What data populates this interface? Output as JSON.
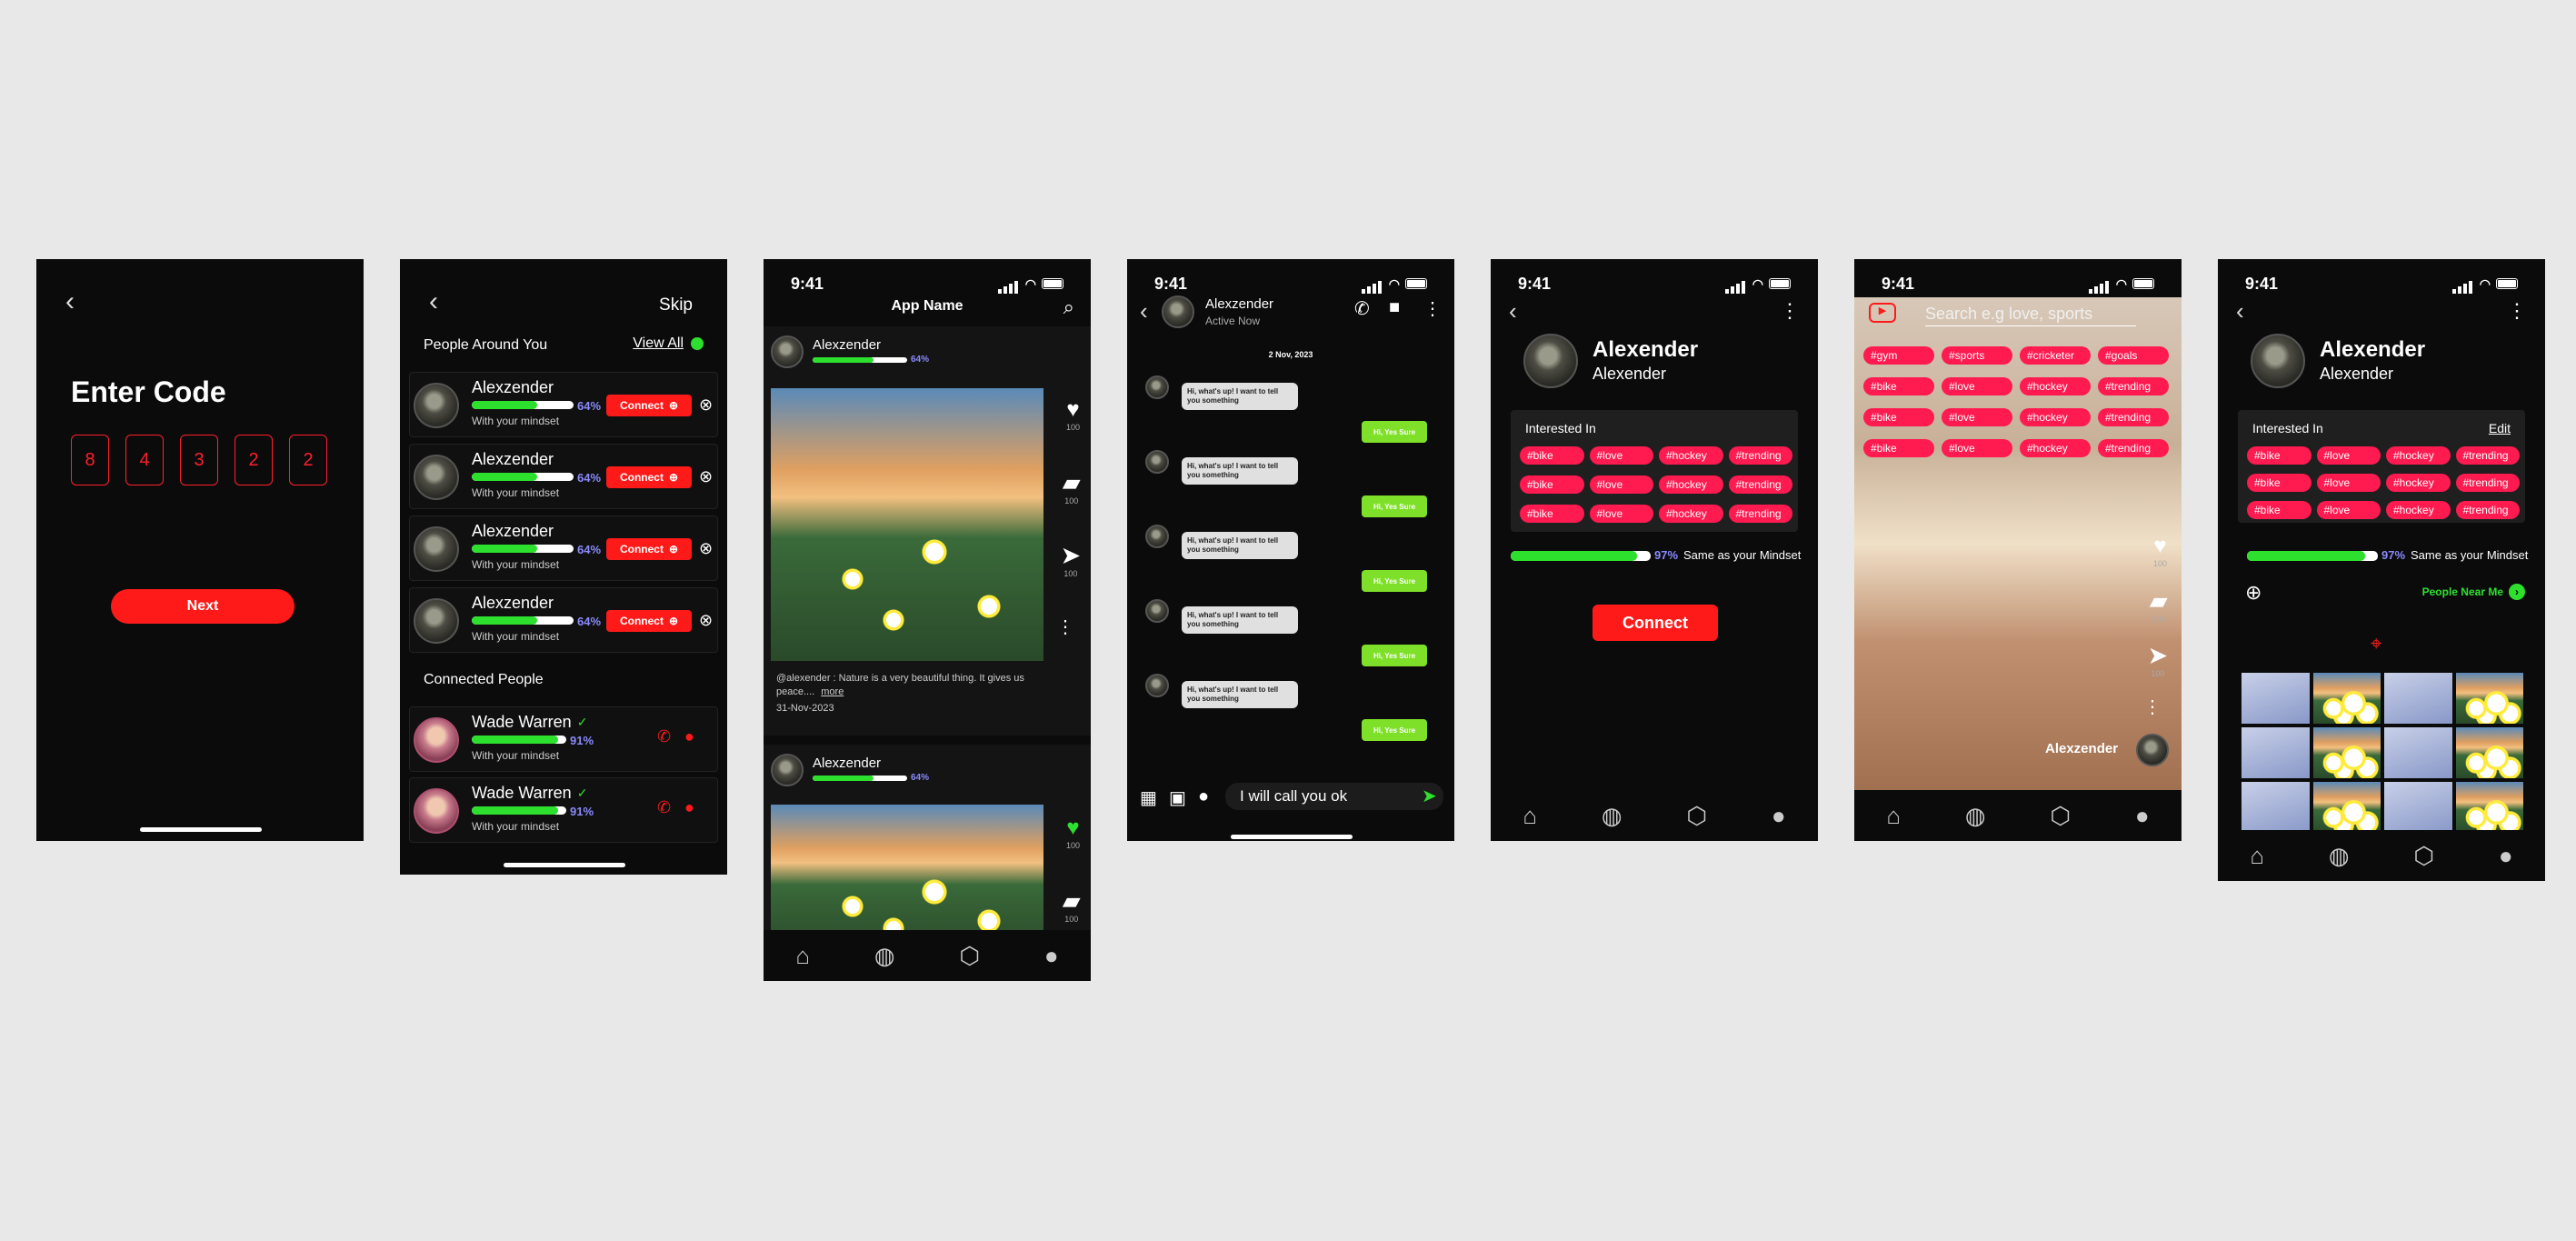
{
  "colors": {
    "accent": "#ff1a1a",
    "green": "#2ee02e",
    "tag": "#ff1a50",
    "bubble_out": "#7fe02a",
    "percent": "#8a8aff"
  },
  "status_time": "9:41",
  "s1": {
    "title": "Enter Code",
    "code": [
      "8",
      "4",
      "3",
      "2",
      "2"
    ],
    "next": "Next"
  },
  "s2": {
    "skip": "Skip",
    "around_title": "People Around You",
    "view_all": "View All",
    "people": [
      {
        "name": "Alexzender",
        "percent": "64%",
        "progress": 0.64,
        "sub": "With your mindset",
        "connect": "Connect"
      },
      {
        "name": "Alexzender",
        "percent": "64%",
        "progress": 0.64,
        "sub": "With your mindset",
        "connect": "Connect"
      },
      {
        "name": "Alexzender",
        "percent": "64%",
        "progress": 0.64,
        "sub": "With your mindset",
        "connect": "Connect"
      },
      {
        "name": "Alexzender",
        "percent": "64%",
        "progress": 0.64,
        "sub": "With your mindset",
        "connect": "Connect"
      }
    ],
    "connected_title": "Connected People",
    "connected": [
      {
        "name": "Wade Warren",
        "percent": "91%",
        "progress": 0.91,
        "sub": "With your mindset"
      },
      {
        "name": "Wade Warren",
        "percent": "91%",
        "progress": 0.91,
        "sub": "With your mindset"
      }
    ]
  },
  "s3": {
    "title": "App Name",
    "post1": {
      "name": "Alexzender",
      "percent": "64%",
      "progress": 0.64,
      "caption": "@alexender : Nature is a very beautiful thing. It gives us peace....",
      "more": "more",
      "date": "31-Nov-2023",
      "likes": "100",
      "comments": "100",
      "shares": "100"
    },
    "post2": {
      "name": "Alexzender",
      "percent": "64%",
      "progress": 0.64,
      "likes": "100",
      "comments": "100"
    }
  },
  "s4": {
    "name": "Alexzender",
    "status": "Active Now",
    "date": "2 Nov, 2023",
    "in_msg": "Hi, what's up! I want to tell you something",
    "out_msg": "Hi, Yes Sure",
    "input": "I will call you ok"
  },
  "s5": {
    "name": "Alexender",
    "username": "Alexender",
    "interested": "Interested In",
    "tags": [
      "#bike",
      "#love",
      "#hockey",
      "#trending",
      "#bike",
      "#love",
      "#hockey",
      "#trending",
      "#bike",
      "#love",
      "#hockey",
      "#trending"
    ],
    "percent": "97%",
    "progress": 0.97,
    "mindset": "Same as your Mindset",
    "connect": "Connect"
  },
  "s6": {
    "search_placeholder": "Search e.g love, sports",
    "tags": [
      "#gym",
      "#sports",
      "#cricketer",
      "#goals",
      "#bike",
      "#love",
      "#hockey",
      "#trending",
      "#bike",
      "#love",
      "#hockey",
      "#trending",
      "#bike",
      "#love",
      "#hockey",
      "#trending"
    ],
    "author": "Alexzender",
    "likes": "100",
    "comments": "100",
    "shares": "100"
  },
  "s7": {
    "name": "Alexender",
    "username": "Alexender",
    "interested": "Interested In",
    "edit": "Edit",
    "tags": [
      "#bike",
      "#love",
      "#hockey",
      "#trending",
      "#bike",
      "#love",
      "#hockey",
      "#trending",
      "#bike",
      "#love",
      "#hockey",
      "#trending"
    ],
    "percent": "97%",
    "progress": 0.97,
    "mindset": "Same as your Mindset",
    "near": "People Near Me"
  }
}
